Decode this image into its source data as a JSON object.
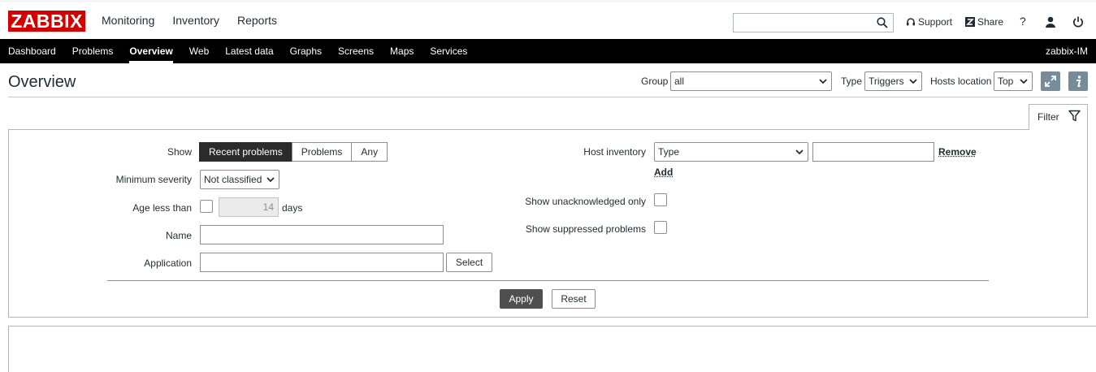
{
  "header": {
    "logo": "ZABBIX",
    "main_nav": [
      "Monitoring",
      "Inventory",
      "Reports"
    ],
    "search": {
      "value": "",
      "placeholder": ""
    },
    "support": "Support",
    "share": "Share",
    "help": "?"
  },
  "subnav": {
    "items": [
      "Dashboard",
      "Problems",
      "Overview",
      "Web",
      "Latest data",
      "Graphs",
      "Screens",
      "Maps",
      "Services"
    ],
    "active": "Overview",
    "user": "zabbix-IM"
  },
  "page": {
    "title": "Overview",
    "group_label": "Group",
    "group_value": "all",
    "type_label": "Type",
    "type_value": "Triggers",
    "hosts_location_label": "Hosts location",
    "hosts_location_value": "Top"
  },
  "filter": {
    "tab_label": "Filter",
    "show_label": "Show",
    "show_options": [
      "Recent problems",
      "Problems",
      "Any"
    ],
    "show_selected": "Recent problems",
    "min_severity_label": "Minimum severity",
    "min_severity_value": "Not classified",
    "age_label": "Age less than",
    "age_value": "14",
    "age_unit": "days",
    "name_label": "Name",
    "application_label": "Application",
    "select_button": "Select",
    "host_inventory_label": "Host inventory",
    "host_inventory_type": "Type",
    "remove_link": "Remove",
    "add_link": "Add",
    "unack_label": "Show unacknowledged only",
    "suppressed_label": "Show suppressed problems",
    "apply_button": "Apply",
    "reset_button": "Reset"
  },
  "colors": {
    "logo_red": "#d40000",
    "nav_black": "#000000",
    "active_segment": "#2b2b2b",
    "apply_button": "#4f4f4f",
    "icon_button": "#768d99"
  }
}
